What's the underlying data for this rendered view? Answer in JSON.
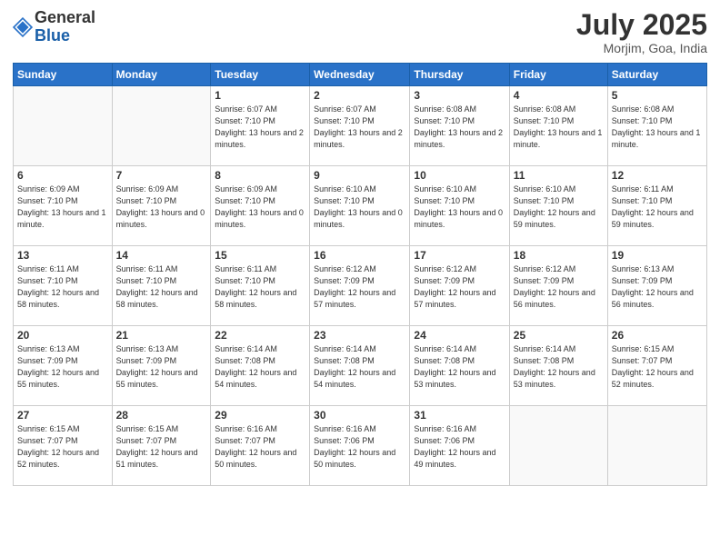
{
  "header": {
    "logo_general": "General",
    "logo_blue": "Blue",
    "month": "July 2025",
    "location": "Morjim, Goa, India"
  },
  "weekdays": [
    "Sunday",
    "Monday",
    "Tuesday",
    "Wednesday",
    "Thursday",
    "Friday",
    "Saturday"
  ],
  "weeks": [
    [
      {
        "day": "",
        "info": ""
      },
      {
        "day": "",
        "info": ""
      },
      {
        "day": "1",
        "info": "Sunrise: 6:07 AM\nSunset: 7:10 PM\nDaylight: 13 hours\nand 2 minutes."
      },
      {
        "day": "2",
        "info": "Sunrise: 6:07 AM\nSunset: 7:10 PM\nDaylight: 13 hours\nand 2 minutes."
      },
      {
        "day": "3",
        "info": "Sunrise: 6:08 AM\nSunset: 7:10 PM\nDaylight: 13 hours\nand 2 minutes."
      },
      {
        "day": "4",
        "info": "Sunrise: 6:08 AM\nSunset: 7:10 PM\nDaylight: 13 hours\nand 1 minute."
      },
      {
        "day": "5",
        "info": "Sunrise: 6:08 AM\nSunset: 7:10 PM\nDaylight: 13 hours\nand 1 minute."
      }
    ],
    [
      {
        "day": "6",
        "info": "Sunrise: 6:09 AM\nSunset: 7:10 PM\nDaylight: 13 hours\nand 1 minute."
      },
      {
        "day": "7",
        "info": "Sunrise: 6:09 AM\nSunset: 7:10 PM\nDaylight: 13 hours\nand 0 minutes."
      },
      {
        "day": "8",
        "info": "Sunrise: 6:09 AM\nSunset: 7:10 PM\nDaylight: 13 hours\nand 0 minutes."
      },
      {
        "day": "9",
        "info": "Sunrise: 6:10 AM\nSunset: 7:10 PM\nDaylight: 13 hours\nand 0 minutes."
      },
      {
        "day": "10",
        "info": "Sunrise: 6:10 AM\nSunset: 7:10 PM\nDaylight: 13 hours\nand 0 minutes."
      },
      {
        "day": "11",
        "info": "Sunrise: 6:10 AM\nSunset: 7:10 PM\nDaylight: 12 hours\nand 59 minutes."
      },
      {
        "day": "12",
        "info": "Sunrise: 6:11 AM\nSunset: 7:10 PM\nDaylight: 12 hours\nand 59 minutes."
      }
    ],
    [
      {
        "day": "13",
        "info": "Sunrise: 6:11 AM\nSunset: 7:10 PM\nDaylight: 12 hours\nand 58 minutes."
      },
      {
        "day": "14",
        "info": "Sunrise: 6:11 AM\nSunset: 7:10 PM\nDaylight: 12 hours\nand 58 minutes."
      },
      {
        "day": "15",
        "info": "Sunrise: 6:11 AM\nSunset: 7:10 PM\nDaylight: 12 hours\nand 58 minutes."
      },
      {
        "day": "16",
        "info": "Sunrise: 6:12 AM\nSunset: 7:09 PM\nDaylight: 12 hours\nand 57 minutes."
      },
      {
        "day": "17",
        "info": "Sunrise: 6:12 AM\nSunset: 7:09 PM\nDaylight: 12 hours\nand 57 minutes."
      },
      {
        "day": "18",
        "info": "Sunrise: 6:12 AM\nSunset: 7:09 PM\nDaylight: 12 hours\nand 56 minutes."
      },
      {
        "day": "19",
        "info": "Sunrise: 6:13 AM\nSunset: 7:09 PM\nDaylight: 12 hours\nand 56 minutes."
      }
    ],
    [
      {
        "day": "20",
        "info": "Sunrise: 6:13 AM\nSunset: 7:09 PM\nDaylight: 12 hours\nand 55 minutes."
      },
      {
        "day": "21",
        "info": "Sunrise: 6:13 AM\nSunset: 7:09 PM\nDaylight: 12 hours\nand 55 minutes."
      },
      {
        "day": "22",
        "info": "Sunrise: 6:14 AM\nSunset: 7:08 PM\nDaylight: 12 hours\nand 54 minutes."
      },
      {
        "day": "23",
        "info": "Sunrise: 6:14 AM\nSunset: 7:08 PM\nDaylight: 12 hours\nand 54 minutes."
      },
      {
        "day": "24",
        "info": "Sunrise: 6:14 AM\nSunset: 7:08 PM\nDaylight: 12 hours\nand 53 minutes."
      },
      {
        "day": "25",
        "info": "Sunrise: 6:14 AM\nSunset: 7:08 PM\nDaylight: 12 hours\nand 53 minutes."
      },
      {
        "day": "26",
        "info": "Sunrise: 6:15 AM\nSunset: 7:07 PM\nDaylight: 12 hours\nand 52 minutes."
      }
    ],
    [
      {
        "day": "27",
        "info": "Sunrise: 6:15 AM\nSunset: 7:07 PM\nDaylight: 12 hours\nand 52 minutes."
      },
      {
        "day": "28",
        "info": "Sunrise: 6:15 AM\nSunset: 7:07 PM\nDaylight: 12 hours\nand 51 minutes."
      },
      {
        "day": "29",
        "info": "Sunrise: 6:16 AM\nSunset: 7:07 PM\nDaylight: 12 hours\nand 50 minutes."
      },
      {
        "day": "30",
        "info": "Sunrise: 6:16 AM\nSunset: 7:06 PM\nDaylight: 12 hours\nand 50 minutes."
      },
      {
        "day": "31",
        "info": "Sunrise: 6:16 AM\nSunset: 7:06 PM\nDaylight: 12 hours\nand 49 minutes."
      },
      {
        "day": "",
        "info": ""
      },
      {
        "day": "",
        "info": ""
      }
    ]
  ]
}
